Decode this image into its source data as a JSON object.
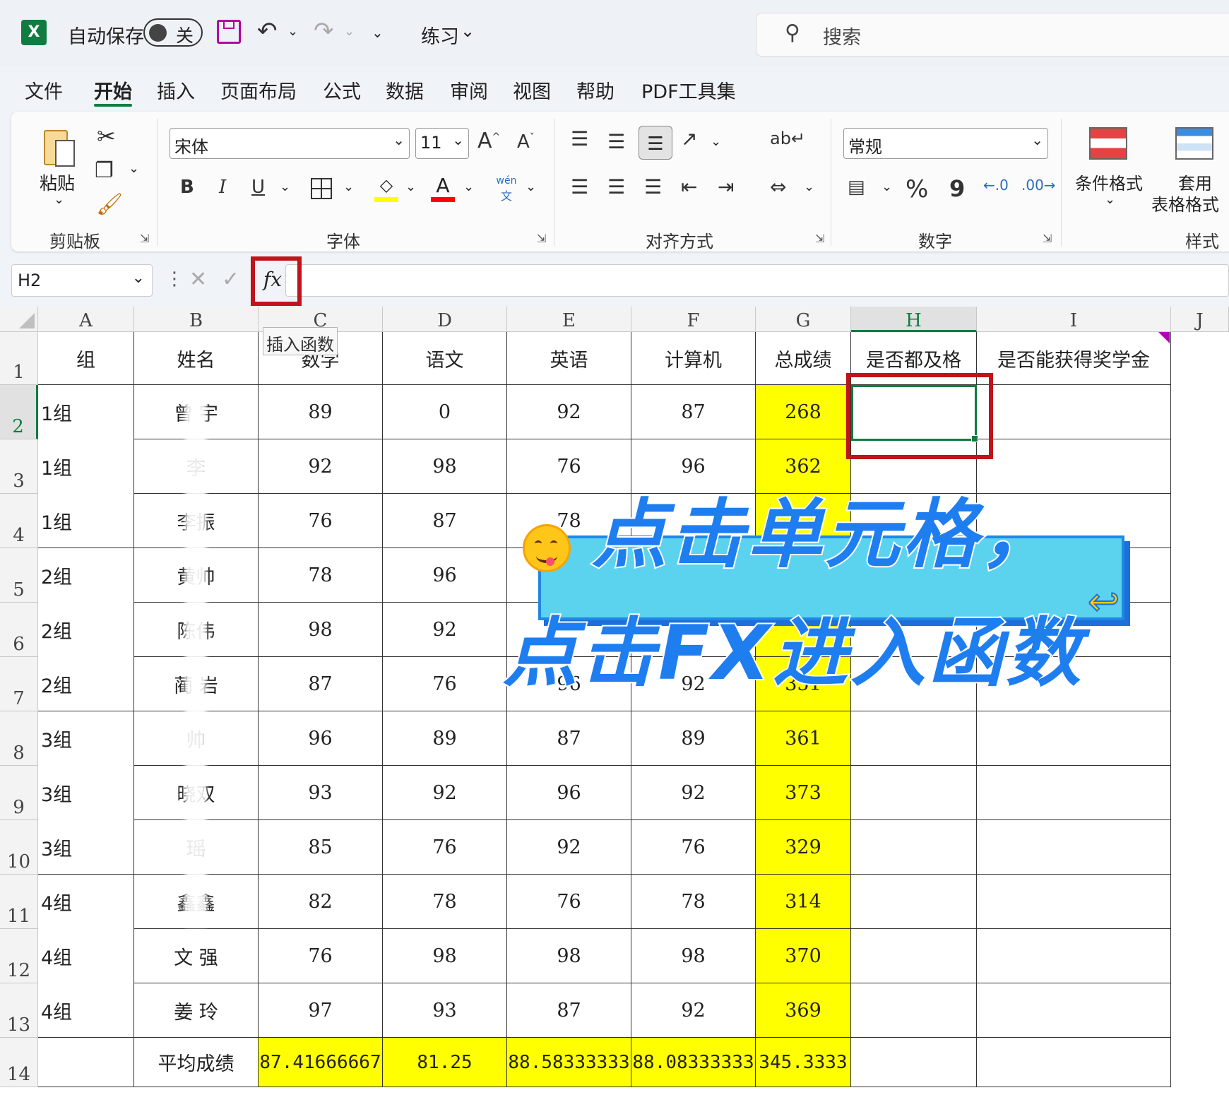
{
  "titlebar": {
    "autosave_label": "自动保存",
    "autosave_state": "关",
    "doc_name": "练习",
    "search_placeholder": "搜索"
  },
  "menu": [
    "文件",
    "开始",
    "插入",
    "页面布局",
    "公式",
    "数据",
    "审阅",
    "视图",
    "帮助",
    "PDF工具集"
  ],
  "ribbon": {
    "paste_label": "粘贴",
    "clipboard_group": "剪贴板",
    "font_name": "宋体",
    "font_size": "11",
    "font_group": "字体",
    "bold": "B",
    "italic": "I",
    "underline": "U",
    "phonetic_top": "wén",
    "phonetic_bottom": "文",
    "align_group": "对齐方式",
    "number_format": "常规",
    "number_group": "数字",
    "percent": "%",
    "comma": "9",
    "cond_format": "条件格式",
    "table_format_l1": "套用",
    "table_format_l2": "表格格式",
    "style_group": "样式"
  },
  "formula_bar": {
    "name_box": "H2",
    "fx_label": "fx",
    "tooltip": "插入函数"
  },
  "sheet": {
    "columns": [
      "A",
      "B",
      "C",
      "D",
      "E",
      "F",
      "G",
      "H",
      "I",
      "J"
    ],
    "rows": [
      "1",
      "2",
      "3",
      "4",
      "5",
      "6",
      "7",
      "8",
      "9",
      "10",
      "11",
      "12",
      "13",
      "14"
    ],
    "header_row": [
      "组",
      "姓名",
      "数学",
      "语文",
      "英语",
      "计算机",
      "总成绩",
      "是否都及格",
      "是否能获得奖学金"
    ],
    "data": [
      [
        "1组",
        "曾 宇",
        "89",
        "0",
        "92",
        "87",
        "268"
      ],
      [
        "1组",
        "李",
        "92",
        "98",
        "76",
        "96",
        "362"
      ],
      [
        "1组",
        "李振",
        "76",
        "87",
        "78",
        "",
        ""
      ],
      [
        "2组",
        "黄帅",
        "78",
        "96",
        "",
        "",
        ""
      ],
      [
        "2组",
        "陈伟",
        "98",
        "92",
        "",
        "",
        ""
      ],
      [
        "2组",
        "蔺 岩",
        "87",
        "76",
        "96",
        "92",
        "351"
      ],
      [
        "3组",
        "帅",
        "96",
        "89",
        "87",
        "89",
        "361"
      ],
      [
        "3组",
        "晓双",
        "93",
        "92",
        "96",
        "92",
        "373"
      ],
      [
        "3组",
        "瑶",
        "85",
        "76",
        "92",
        "76",
        "329"
      ],
      [
        "4组",
        "鑫鑫",
        "82",
        "78",
        "76",
        "78",
        "314"
      ],
      [
        "4组",
        "文 强",
        "76",
        "98",
        "98",
        "98",
        "370"
      ],
      [
        "4组",
        "姜 玲",
        "97",
        "93",
        "87",
        "92",
        "369"
      ]
    ],
    "avg_label": "平均成绩",
    "avg_values": [
      "87.41666667",
      "81.25",
      "88.58333333",
      "88.08333333",
      "345.3333"
    ]
  },
  "overlay": {
    "line1": "点击单元格，",
    "line2": "点击FX进入函数"
  },
  "colors": {
    "excel_green": "#107c41",
    "highlight_yellow": "#ffff00",
    "annotation_red": "#c0141a",
    "banner_blue": "#1e7ef0",
    "banner_fill": "#5bd3ef"
  }
}
